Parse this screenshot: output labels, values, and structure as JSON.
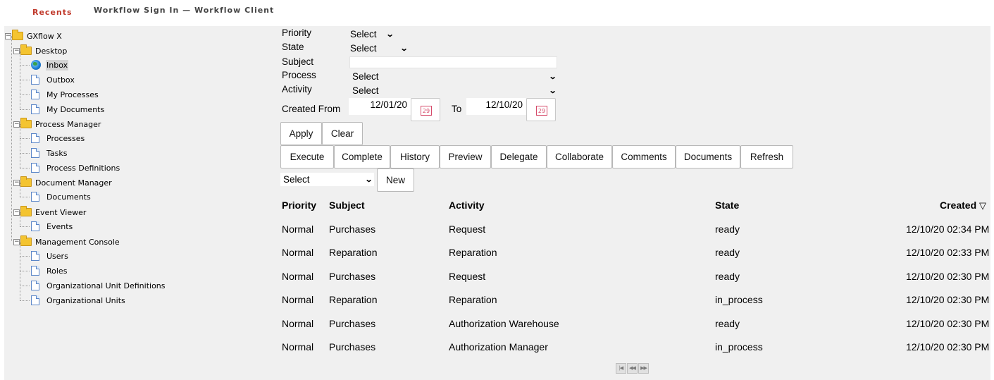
{
  "header": {
    "recents": "Recents",
    "title": "Workflow Sign In — Workflow Client"
  },
  "tree": {
    "root": "GXflow X",
    "desktop": "Desktop",
    "inbox": "Inbox",
    "outbox": "Outbox",
    "my_processes": "My Processes",
    "my_documents": "My Documents",
    "process_manager": "Process Manager",
    "processes": "Processes",
    "tasks": "Tasks",
    "process_definitions": "Process Definitions",
    "document_manager": "Document Manager",
    "documents": "Documents",
    "event_viewer": "Event Viewer",
    "events": "Events",
    "management_console": "Management Console",
    "users": "Users",
    "roles": "Roles",
    "org_unit_definitions": "Organizational Unit Definitions",
    "org_units": "Organizational Units",
    "expander_symbol": "−",
    "icons": {
      "folder": "folder-icon",
      "document": "document-icon",
      "inbox": "globe-icon"
    },
    "selected_item": "Inbox"
  },
  "filters": {
    "priority_label": "Priority",
    "priority_value": "Select",
    "state_label": "State",
    "state_value": "Select",
    "subject_label": "Subject",
    "subject_value": "",
    "process_label": "Process",
    "process_value": "Select",
    "activity_label": "Activity",
    "activity_value": "Select",
    "created_from_label": "Created From",
    "created_from_value": "12/01/20",
    "to_label": "To",
    "to_value": "12/10/20",
    "calendar_day": "29"
  },
  "buttons": {
    "apply": "Apply",
    "clear": "Clear",
    "execute": "Execute",
    "complete": "Complete",
    "history": "History",
    "preview": "Preview",
    "delegate": "Delegate",
    "collaborate": "Collaborate",
    "comments": "Comments",
    "documents": "Documents",
    "refresh": "Refresh",
    "new": "New"
  },
  "new_select": {
    "value": "Select"
  },
  "grid": {
    "columns": {
      "priority": "Priority",
      "subject": "Subject",
      "activity": "Activity",
      "state": "State",
      "created": "Created",
      "sort_indicator": "▽"
    },
    "rows": [
      {
        "priority": "Normal",
        "subject": "Purchases",
        "activity": "Request",
        "state": "ready",
        "created": "12/10/20 02:34 PM"
      },
      {
        "priority": "Normal",
        "subject": "Reparation",
        "activity": "Reparation",
        "state": "ready",
        "created": "12/10/20 02:33 PM"
      },
      {
        "priority": "Normal",
        "subject": "Purchases",
        "activity": "Request",
        "state": "ready",
        "created": "12/10/20 02:30 PM"
      },
      {
        "priority": "Normal",
        "subject": "Reparation",
        "activity": "Reparation",
        "state": "in_process",
        "created": "12/10/20 02:30 PM"
      },
      {
        "priority": "Normal",
        "subject": "Purchases",
        "activity": "Authorization Warehouse",
        "state": "ready",
        "created": "12/10/20 02:30 PM"
      },
      {
        "priority": "Normal",
        "subject": "Purchases",
        "activity": "Authorization Manager",
        "state": "in_process",
        "created": "12/10/20 02:30 PM"
      }
    ]
  },
  "pager": {
    "first": "|◀",
    "prev": "◀◀",
    "next": "▶▶"
  },
  "colors": {
    "recents": "#c0392b",
    "panel_bg": "#f0f0f0",
    "folder": "#f4c430",
    "calendar": "#d64a6a"
  }
}
